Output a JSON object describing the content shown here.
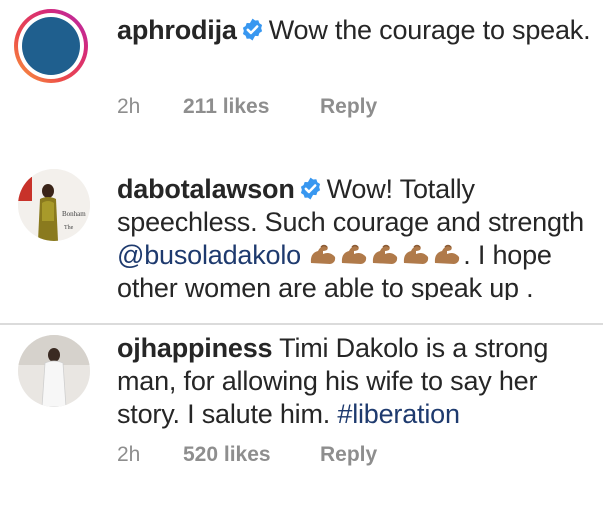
{
  "comments": [
    {
      "username": "aphrodija",
      "verified": true,
      "text": "Wow the courage to speak.",
      "time": "2h",
      "likes": "211 likes",
      "reply": "Reply"
    },
    {
      "username": "dabotalawson",
      "verified": true,
      "text_before": "Wow! Totally speechless. Such courage and strength ",
      "mention": "@busoladakolo",
      "emojis": [
        "flexed-biceps",
        "flexed-biceps",
        "flexed-biceps",
        "flexed-biceps",
        "flexed-biceps"
      ],
      "text_after": ". I hope other women are able to speak up ."
    },
    {
      "username": "ojhappiness",
      "verified": false,
      "text": "Timi Dakolo is a strong man, for allowing his wife to say her story. I salute him. ",
      "hashtag": "#liberation",
      "time": "2h",
      "likes": "520 likes",
      "reply": "Reply"
    }
  ],
  "colors": {
    "verified_badge": "#3897f0",
    "link": "#1e3a6e",
    "meta_text": "#8e8e8e",
    "divider": "#dbdbdb"
  },
  "icons": {
    "verified": "verified-badge-icon",
    "emoji": "flexed-biceps-emoji"
  }
}
